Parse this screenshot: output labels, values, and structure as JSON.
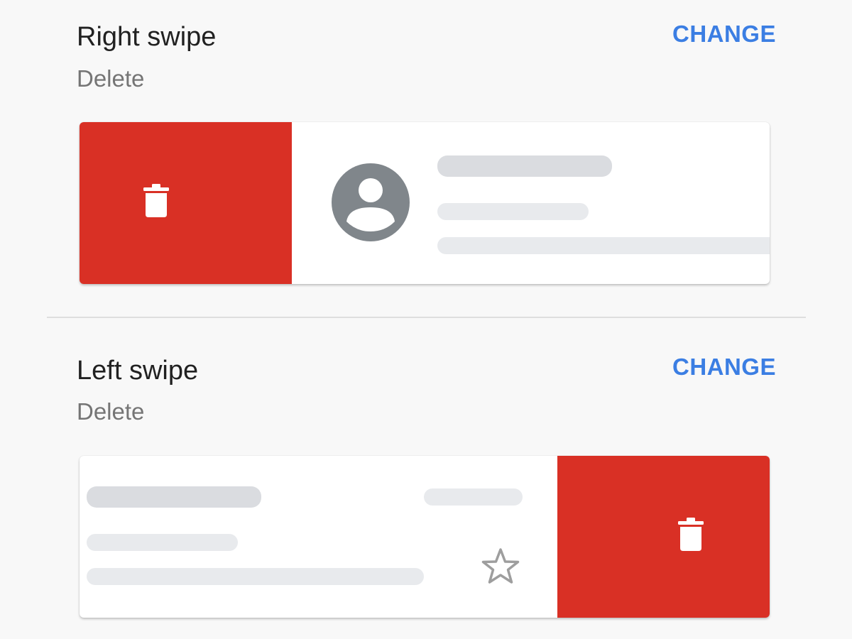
{
  "right_swipe": {
    "title": "Right swipe",
    "action": "Delete",
    "change_label": "CHANGE"
  },
  "left_swipe": {
    "title": "Left swipe",
    "action": "Delete",
    "change_label": "CHANGE"
  },
  "icons": {
    "action": "trash-icon",
    "avatar": "account-circle-icon",
    "star": "star-outline-icon"
  },
  "colors": {
    "action_background": "#d93025",
    "link": "#3b7ee3",
    "avatar": "#80868b",
    "background": "#f8f8f8"
  }
}
